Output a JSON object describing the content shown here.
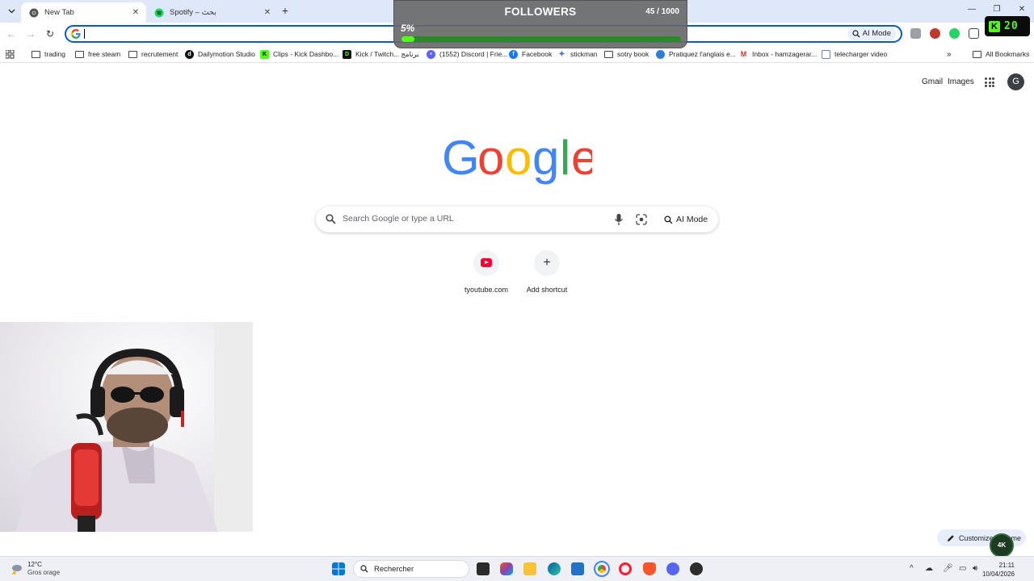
{
  "tabs": [
    {
      "title": "New Tab",
      "active": true
    },
    {
      "title": "Spotify – بحث",
      "active": false
    }
  ],
  "omnibox": {
    "value": "",
    "ai_mode_label": "AI Mode"
  },
  "bookmarks": [
    {
      "label": "trading",
      "icon": "folder-icon"
    },
    {
      "label": "free steam",
      "icon": "folder-icon"
    },
    {
      "label": "recrutement",
      "icon": "folder-icon"
    },
    {
      "label": "Dailymotion Studio",
      "icon": "dailymotion-icon"
    },
    {
      "label": "Clips - Kick Dashbo...",
      "icon": "kick-icon"
    },
    {
      "label": "Kick / Twitch... برنامج",
      "icon": "d-icon"
    },
    {
      "label": "(1552) Discord | Frie...",
      "icon": "discord-icon"
    },
    {
      "label": "Facebook",
      "icon": "facebook-icon"
    },
    {
      "label": "stickman",
      "icon": "sparkle-icon"
    },
    {
      "label": "sotry book",
      "icon": "folder-icon"
    },
    {
      "label": "Pratiquez l'anglais e...",
      "icon": "globe-icon"
    },
    {
      "label": "Inbox - hamzagerar...",
      "icon": "gmail-icon"
    },
    {
      "label": "telecharger video",
      "icon": "doc-icon"
    }
  ],
  "all_bookmarks_label": "All Bookmarks",
  "followers_overlay": {
    "title": "FOLLOWERS",
    "count": "45 / 1000",
    "percent_label": "5%",
    "progress": 0.045
  },
  "kick_widget": {
    "count": "20"
  },
  "ntp": {
    "gmail_label": "Gmail",
    "images_label": "Images",
    "avatar_letter": "G",
    "search_placeholder": "Search Google or type a URL",
    "ai_mode_label": "AI Mode",
    "shortcuts": [
      {
        "label": "tyoutube.com",
        "icon": "youtube-icon"
      },
      {
        "label": "Add shortcut",
        "icon": "plus-icon"
      }
    ],
    "customize_label": "Customize Chrome",
    "badge_label": "4K"
  },
  "taskbar": {
    "temperature": "12°C",
    "weather_desc": "Gros orage",
    "search_label": "Rechercher",
    "time": "21:11",
    "date": "10/04/2026"
  },
  "colors": {
    "accent": "#0b57d0",
    "kick_green": "#53fc18",
    "tab_strip": "#dee8f8"
  }
}
